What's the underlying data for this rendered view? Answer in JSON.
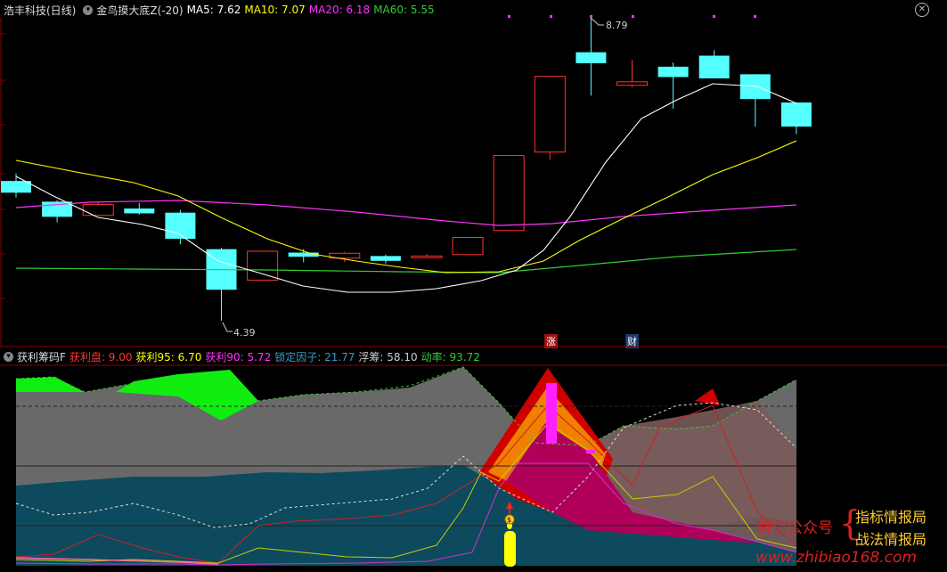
{
  "main_header": {
    "stock": "浩丰科技(日线)",
    "indicator": "金鸟摸大底Z(-20)",
    "ma5_label": "MA5: ",
    "ma5": "7.62",
    "ma10_label": "MA10: ",
    "ma10": "7.07",
    "ma20_label": "MA20: ",
    "ma20": "6.18",
    "ma60_label": "MA60: ",
    "ma60": "5.55"
  },
  "sub_header": {
    "indicator": "获利筹码F",
    "profit_label": "获利盘: ",
    "profit": "9.00",
    "p95_label": "获利95: ",
    "p95": "6.70",
    "p90_label": "获利90: ",
    "p90": "5.72",
    "lock_label": "锁定因子: ",
    "lock": "21.77",
    "float_label": "浮筹: ",
    "float": "58.10",
    "momentum_label": "动率: ",
    "momentum": "93.72"
  },
  "annotations": {
    "high": "8.79",
    "low": "4.39",
    "tag_zhang": "涨",
    "tag_cai": "财",
    "coin": "$"
  },
  "watermark": {
    "left": "微信公众号",
    "right1": "指标情报局",
    "right2": "战法情报局",
    "url": "www.zhibiao168.com"
  },
  "colors": {
    "up": "#ff3333",
    "down": "#54ffff",
    "ma5": "#ffffff",
    "ma10": "#ffff00",
    "ma20": "#ff33ff",
    "ma60": "#33cc33"
  },
  "candles": [
    {
      "o": 6.42,
      "c": 6.25,
      "h": 6.53,
      "l": 6.18
    },
    {
      "o": 6.12,
      "c": 5.9,
      "h": 6.14,
      "l": 5.82
    },
    {
      "o": 5.92,
      "c": 6.08,
      "h": 6.12,
      "l": 5.92
    },
    {
      "o": 6.02,
      "c": 5.95,
      "h": 6.1,
      "l": 5.93
    },
    {
      "o": 5.96,
      "c": 5.58,
      "h": 6.0,
      "l": 5.5
    },
    {
      "o": 5.43,
      "c": 4.84,
      "h": 5.45,
      "l": 4.39
    },
    {
      "o": 4.98,
      "c": 5.4,
      "h": 5.4,
      "l": 4.98
    },
    {
      "o": 5.38,
      "c": 5.32,
      "h": 5.43,
      "l": 5.24
    },
    {
      "o": 5.3,
      "c": 5.37,
      "h": 5.39,
      "l": 5.24
    },
    {
      "o": 5.33,
      "c": 5.26,
      "h": 5.35,
      "l": 5.22
    },
    {
      "o": 5.31,
      "c": 5.33,
      "h": 5.36,
      "l": 5.3
    },
    {
      "o": 5.35,
      "c": 5.6,
      "h": 5.6,
      "l": 5.35
    },
    {
      "o": 5.7,
      "c": 6.79,
      "h": 6.79,
      "l": 5.7
    },
    {
      "o": 6.84,
      "c": 7.94,
      "h": 7.94,
      "l": 6.73
    },
    {
      "o": 8.29,
      "c": 8.13,
      "h": 8.79,
      "l": 7.66
    },
    {
      "o": 7.81,
      "c": 7.86,
      "h": 8.18,
      "l": 7.78
    },
    {
      "o": 8.08,
      "c": 7.93,
      "h": 8.14,
      "l": 7.47
    },
    {
      "o": 8.24,
      "c": 7.91,
      "h": 8.32,
      "l": 7.91
    },
    {
      "o": 7.97,
      "c": 7.61,
      "h": 7.97,
      "l": 7.21
    },
    {
      "o": 7.56,
      "c": 7.21,
      "h": 7.56,
      "l": 7.1
    }
  ]
}
